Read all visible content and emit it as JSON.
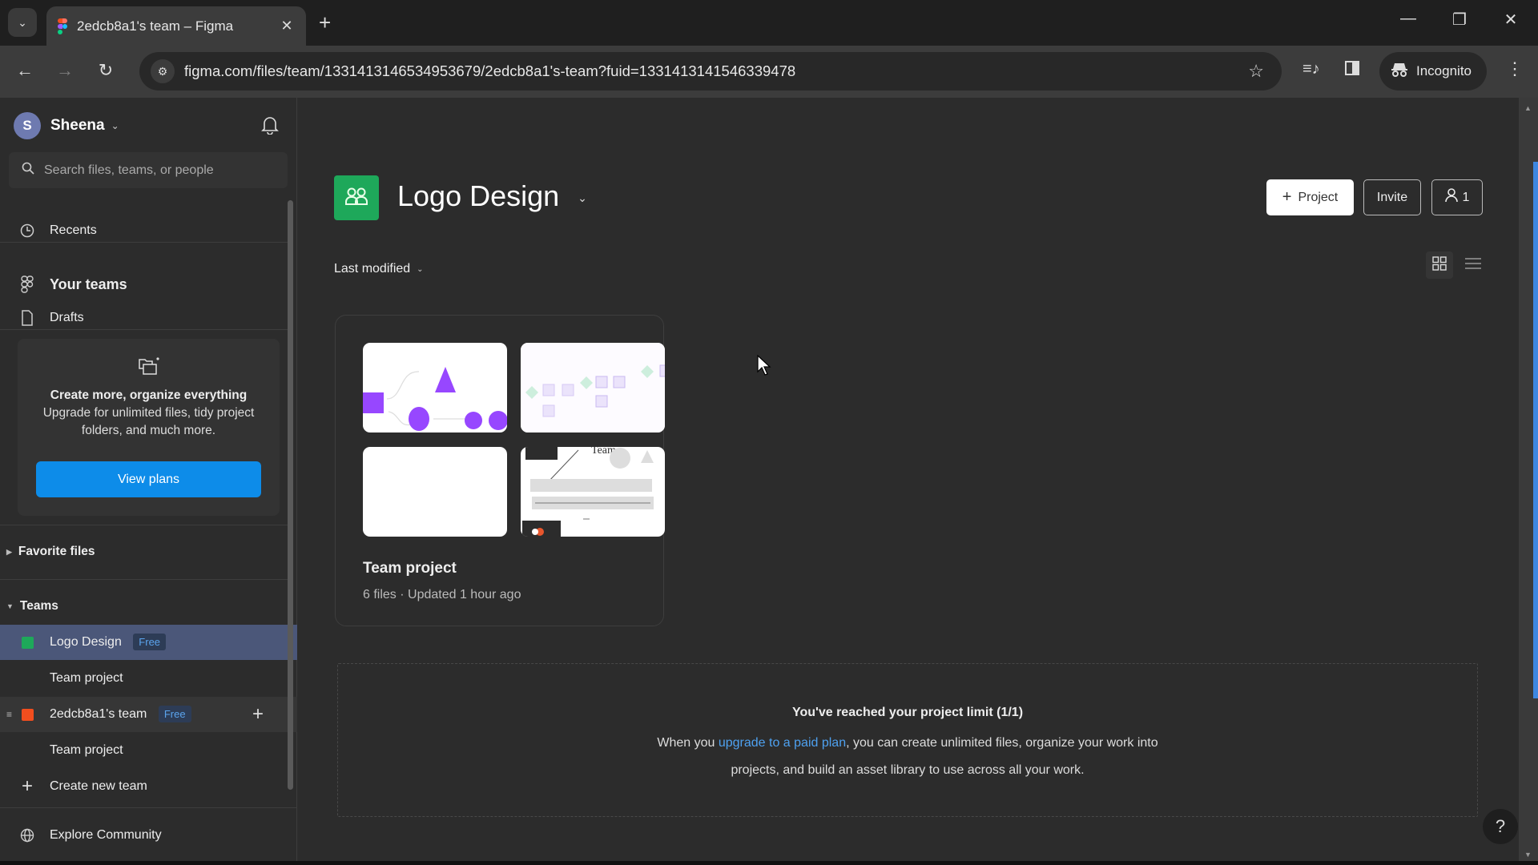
{
  "browser": {
    "tab_title": "2edcb8a1's team – Figma",
    "url": "figma.com/files/team/1331413146534953679/2edcb8a1's-team?fuid=1331413141546339478",
    "incognito_label": "Incognito",
    "icons": [
      "tab-search-icon",
      "figma-favicon",
      "close-icon",
      "plus-icon",
      "minimize-icon",
      "restore-icon",
      "close-window-icon",
      "back-icon",
      "forward-icon",
      "reload-icon",
      "site-info-icon",
      "bookmark-star-icon",
      "media-icon",
      "side-panel-icon",
      "incognito-icon",
      "more-menu-icon"
    ]
  },
  "sidebar": {
    "user": {
      "initial": "S",
      "name": "Sheena"
    },
    "search_placeholder": "Search files, teams, or people",
    "nav": {
      "recents": "Recents",
      "your_teams": "Your teams",
      "drafts": "Drafts"
    },
    "upsell": {
      "title": "Create more, organize everything",
      "body": "Upgrade for unlimited files, tidy project folders, and much more.",
      "button": "View plans"
    },
    "favorite_files": "Favorite files",
    "teams_header": "Teams",
    "teams": [
      {
        "name": "Logo Design",
        "badge": "Free",
        "color": "#1ea85a",
        "projects": [
          "Team project"
        ],
        "active": true
      },
      {
        "name": "2edcb8a1's team",
        "badge": "Free",
        "color": "#f24e1e",
        "projects": [
          "Team project"
        ],
        "active": false
      }
    ],
    "create_team": "Create new team",
    "explore": "Explore Community"
  },
  "main": {
    "team_title": "Logo Design",
    "buttons": {
      "project": "Project",
      "invite": "Invite",
      "members_count": "1"
    },
    "sort_label": "Last modified",
    "project_card": {
      "name": "Team project",
      "meta": "6 files · Updated 1 hour ago"
    },
    "limit": {
      "title": "You've reached your project limit (1/1)",
      "body_before": "When you ",
      "link": "upgrade to a paid plan",
      "body_after": ", you can create unlimited files, organize your work into projects, and build an asset library to use across all your work."
    },
    "help_label": "?"
  },
  "colors": {
    "accent_blue": "#0d8ce9",
    "team_green": "#1ea85a",
    "team_red": "#f24e1e",
    "link_blue": "#4ea1f0",
    "active_row": "#4b5779"
  }
}
